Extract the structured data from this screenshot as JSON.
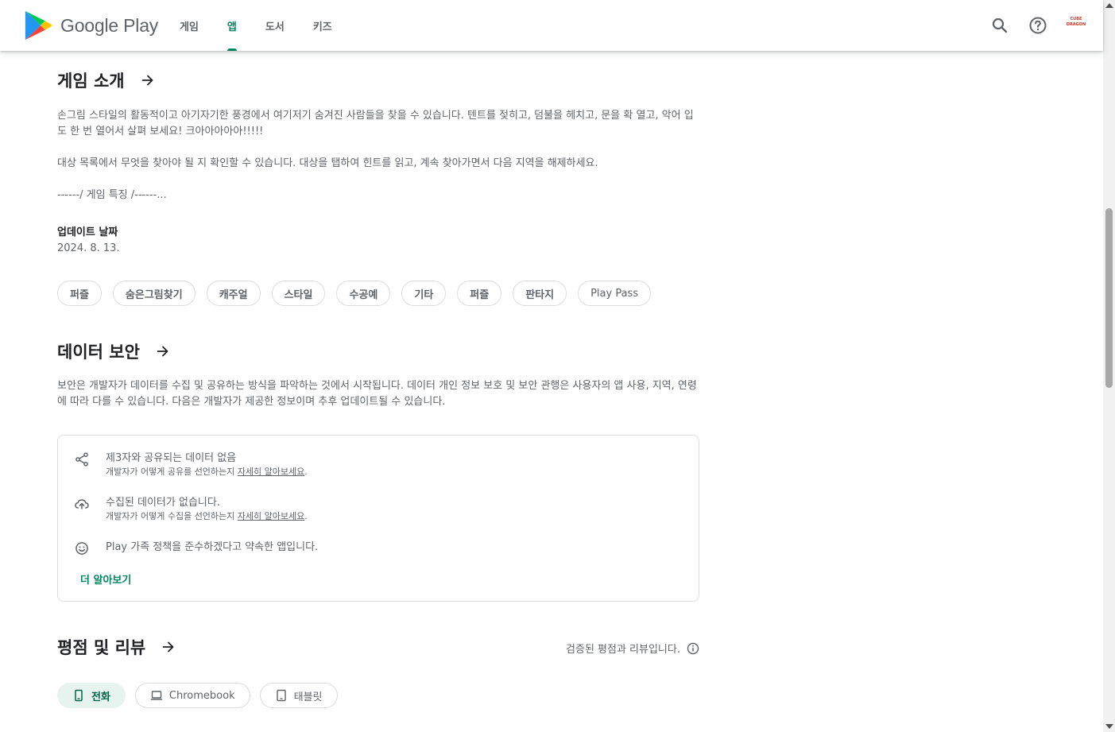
{
  "header": {
    "logo_text": "Google Play",
    "nav": [
      {
        "label": "게임",
        "active": false
      },
      {
        "label": "앱",
        "active": true
      },
      {
        "label": "도서",
        "active": false
      },
      {
        "label": "키즈",
        "active": false
      }
    ],
    "search_icon": "search-icon",
    "help_icon": "help-icon",
    "avatar_text": [
      "CUBE",
      "DRAGON"
    ],
    "accent_color": "#01875f"
  },
  "about": {
    "title": "게임 소개",
    "paragraphs": [
      "손그림 스타일의 활동적이고 아기자기한 풍경에서 여기저기 숨겨진 사람들을 찾을 수 있습니다. 텐트를 젖히고, 덤불을 헤치고, 문을 확 열고, 악어 입도 한 번 열어서 살펴 보세요! 크아아아아아!!!!!",
      "대상 목록에서 무엇을 찾아야 될 지 확인할 수 있습니다. 대상을 탭하여 힌트를 읽고, 계속 찾아가면서 다음 지역을 해제하세요.",
      "------/ 게임 특징 /------..."
    ],
    "updated_label": "업데이트 날짜",
    "updated_value": "2024. 8. 13.",
    "tags": [
      "퍼즐",
      "숨은그림찾기",
      "캐주얼",
      "스타일",
      "수공예",
      "기타",
      "퍼즐",
      "판타지",
      "Play Pass"
    ]
  },
  "data_safety": {
    "title": "데이터 보안",
    "description": "보안은 개발자가 데이터를 수집 및 공유하는 방식을 파악하는 것에서 시작됩니다. 데이터 개인 정보 보호 및 보안 관행은 사용자의 앱 사용, 지역, 연령에 따라 다를 수 있습니다. 다음은 개발자가 제공한 정보이며 추후 업데이트될 수 있습니다.",
    "items": [
      {
        "icon": "share-icon",
        "main": "제3자와 공유되는 데이터 없음",
        "sub_prefix": "개발자가 어떻게 공유를 선언하는지 ",
        "sub_link": "자세히 알아보세요",
        "sub_suffix": "."
      },
      {
        "icon": "cloud-upload-icon",
        "main": "수집된 데이터가 없습니다.",
        "sub_prefix": "개발자가 어떻게 수집을 선언하는지 ",
        "sub_link": "자세히 알아보세요",
        "sub_suffix": "."
      },
      {
        "icon": "family-smile-icon",
        "main": "Play 가족 정책을 준수하겠다고 약속한 앱입니다."
      }
    ],
    "more_link": "더 알아보기"
  },
  "reviews": {
    "title": "평점 및 리뷰",
    "note": "검증된 평점과 리뷰입니다.",
    "device_tabs": [
      {
        "label": "전화",
        "icon": "phone-icon",
        "active": true
      },
      {
        "label": "Chromebook",
        "icon": "laptop-icon",
        "active": false
      },
      {
        "label": "태블릿",
        "icon": "tablet-icon",
        "active": false
      }
    ]
  }
}
